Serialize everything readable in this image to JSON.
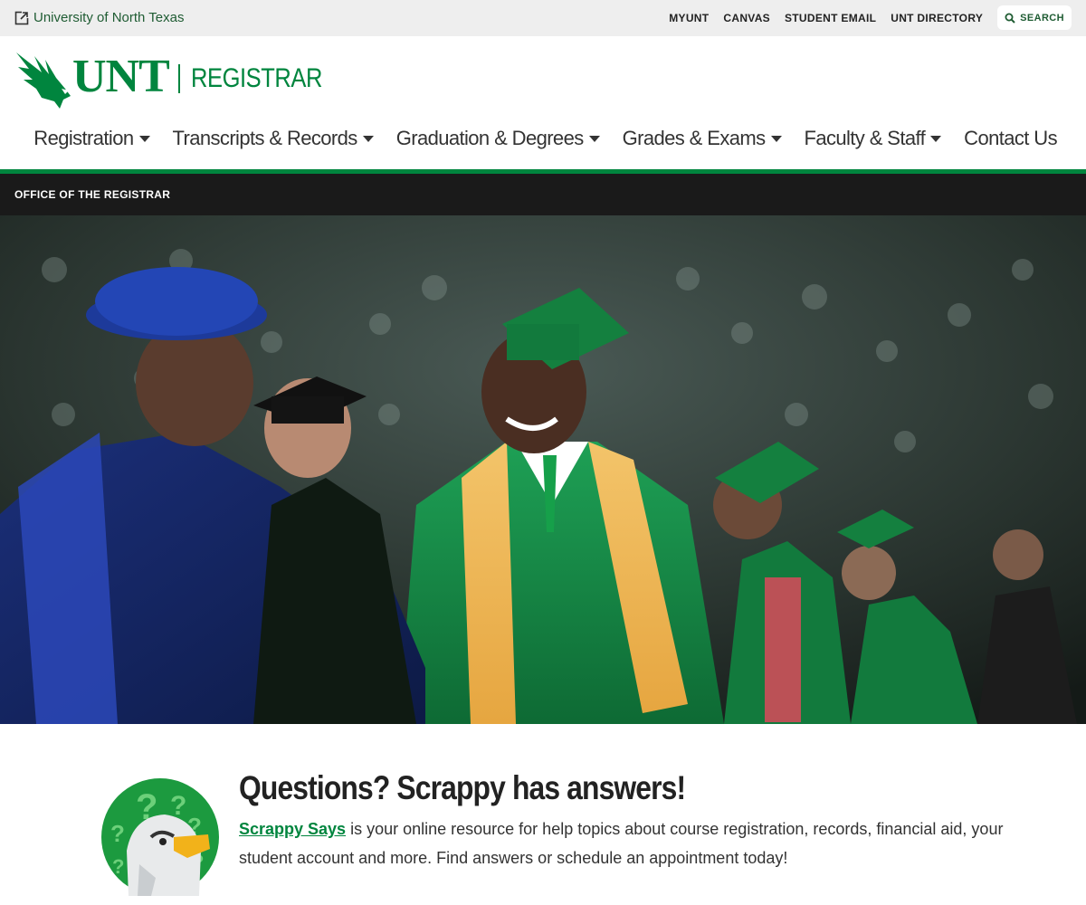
{
  "utility": {
    "university_link": "University of North Texas",
    "links": [
      "MYUNT",
      "CANVAS",
      "STUDENT EMAIL",
      "UNT DIRECTORY"
    ],
    "search_label": "SEARCH"
  },
  "header": {
    "logo_text": "UNT",
    "site_name": "REGISTRAR",
    "nav": [
      {
        "label": "Registration",
        "dropdown": true
      },
      {
        "label": "Transcripts & Records",
        "dropdown": true
      },
      {
        "label": "Graduation & Degrees",
        "dropdown": true
      },
      {
        "label": "Grades & Exams",
        "dropdown": true
      },
      {
        "label": "Faculty & Staff",
        "dropdown": true
      },
      {
        "label": "Contact Us",
        "dropdown": false
      }
    ]
  },
  "office_bar": {
    "label": "OFFICE OF THE REGISTRAR"
  },
  "hero": {
    "image_icon": "graduation-photo"
  },
  "questions": {
    "title": "Questions? Scrappy has answers!",
    "link_text": "Scrappy Says",
    "body": " is your online resource for help topics about course registration, records, financial aid, your student account and more. Find answers or schedule an appointment today!"
  },
  "colors": {
    "brand_green": "#00853e",
    "dark_bar": "#1a1a1a",
    "utility_bg": "#eeeeee"
  }
}
